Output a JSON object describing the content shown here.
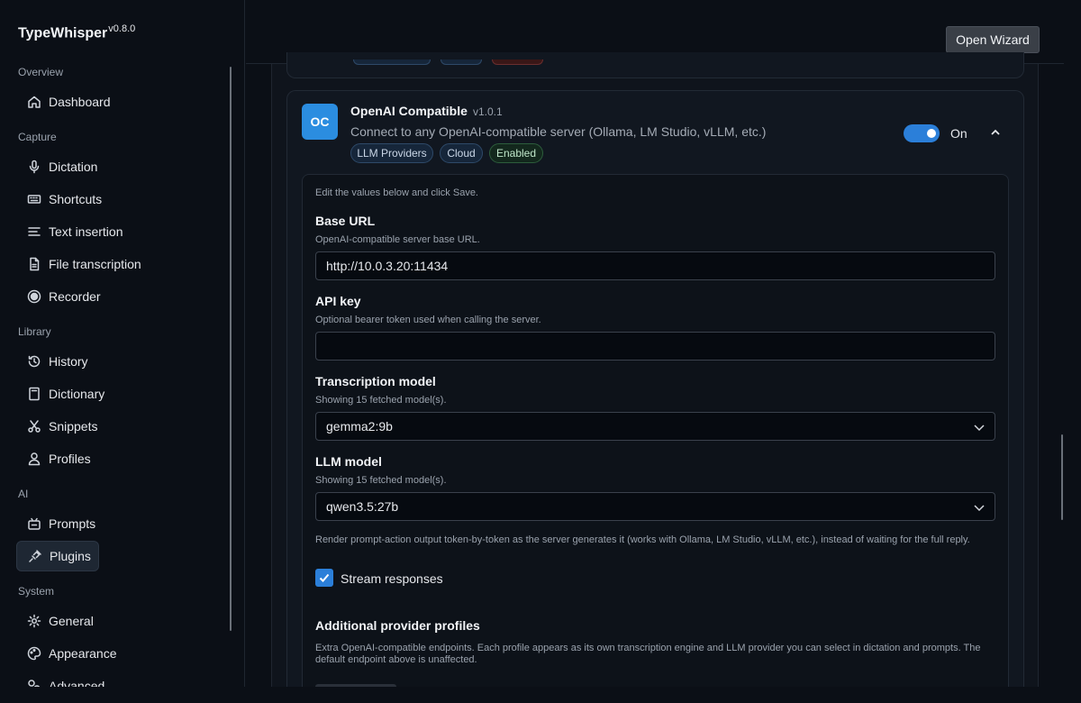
{
  "app": {
    "name": "TypeWhisper",
    "version": "v0.8.0"
  },
  "sidebar": {
    "sections": [
      {
        "label": "Overview"
      },
      {
        "label": "Capture"
      },
      {
        "label": "Library"
      },
      {
        "label": "AI"
      },
      {
        "label": "System"
      }
    ],
    "items": [
      {
        "label": "Dashboard",
        "icon": "home-icon"
      },
      {
        "label": "Dictation",
        "icon": "microphone-icon"
      },
      {
        "label": "Shortcuts",
        "icon": "keyboard-icon"
      },
      {
        "label": "Text insertion",
        "icon": "text-lines-icon"
      },
      {
        "label": "File transcription",
        "icon": "file-icon"
      },
      {
        "label": "Recorder",
        "icon": "record-icon"
      },
      {
        "label": "History",
        "icon": "history-icon"
      },
      {
        "label": "Dictionary",
        "icon": "book-icon"
      },
      {
        "label": "Snippets",
        "icon": "scissors-icon"
      },
      {
        "label": "Profiles",
        "icon": "user-icon"
      },
      {
        "label": "Prompts",
        "icon": "sparkles-icon"
      },
      {
        "label": "Plugins",
        "icon": "plug-icon",
        "active": true
      },
      {
        "label": "General",
        "icon": "gear-icon"
      },
      {
        "label": "Appearance",
        "icon": "palette-icon"
      },
      {
        "label": "Advanced",
        "icon": "advanced-icon"
      }
    ]
  },
  "topbar": {
    "wizard_label": "Open Wizard"
  },
  "plugin": {
    "badge": "OC",
    "name": "OpenAI Compatible",
    "version": "v1.0.1",
    "description": "Connect to any OpenAI-compatible server (Ollama, LM Studio, vLLM, etc.)",
    "tags": [
      "LLM Providers",
      "Cloud",
      "Enabled"
    ],
    "toggle_label": "On",
    "enabled": true,
    "accent_color": "#2b8de0"
  },
  "settings": {
    "intro": "Edit the values below and click Save.",
    "base_url": {
      "label": "Base URL",
      "hint": "OpenAI-compatible server base URL.",
      "value": "http://10.0.3.20:11434"
    },
    "api_key": {
      "label": "API key",
      "hint": "Optional bearer token used when calling the server.",
      "value": ""
    },
    "transcription_model": {
      "label": "Transcription model",
      "hint": "Showing 15 fetched model(s).",
      "value": "gemma2:9b"
    },
    "llm_model": {
      "label": "LLM model",
      "hint": "Showing 15 fetched model(s).",
      "value": "qwen3.5:27b"
    },
    "stream": {
      "hint": "Render prompt-action output token-by-token as the server generates it (works with Ollama, LM Studio, vLLM, etc.), instead of waiting for the full reply.",
      "label": "Stream responses",
      "checked": true
    },
    "profiles": {
      "title": "Additional provider profiles",
      "hint": "Extra OpenAI-compatible endpoints. Each profile appears as its own transcription engine and LLM provider you can select in dictation and prompts. The default endpoint above is unaffected."
    }
  }
}
